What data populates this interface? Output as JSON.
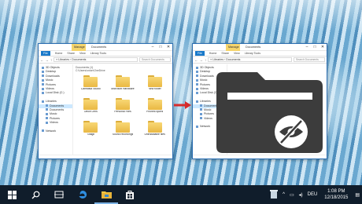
{
  "window_left": {
    "manage_tab": "Manage",
    "title": "Documents",
    "ribbon_tabs": [
      "File",
      "Home",
      "Share",
      "View",
      "Library Tools"
    ],
    "path": "« Libraries › Documents",
    "search_placeholder": "Search Documents",
    "location_line1": "Documents (1)",
    "location_line2": "C:\\Users\\onion\\OneDrive",
    "nav_items": [
      {
        "label": "3D Objects",
        "sel": false,
        "sub": false
      },
      {
        "label": "Desktop",
        "sel": false,
        "sub": false
      },
      {
        "label": "Downloads",
        "sel": false,
        "sub": false
      },
      {
        "label": "Music",
        "sel": false,
        "sub": false
      },
      {
        "label": "Pictures",
        "sel": false,
        "sub": false
      },
      {
        "label": "Videos",
        "sel": false,
        "sub": false
      },
      {
        "label": "Local Disk (C:)",
        "sel": false,
        "sub": false
      },
      {
        "label": "",
        "sel": false,
        "sub": false
      },
      {
        "label": "Libraries",
        "sel": false,
        "sub": false
      },
      {
        "label": "Documents",
        "sel": true,
        "sub": true
      },
      {
        "label": "Documents",
        "sel": false,
        "sub": true
      },
      {
        "label": "Music",
        "sel": false,
        "sub": true
      },
      {
        "label": "Pictures",
        "sel": false,
        "sub": true
      },
      {
        "label": "Videos",
        "sel": false,
        "sub": true
      },
      {
        "label": "",
        "sel": false,
        "sub": false
      },
      {
        "label": "Network",
        "sel": false,
        "sub": false
      }
    ],
    "files": [
      "Camtasia Studio",
      "Microsoft Hardware",
      "New folder",
      "Office Lens",
      "Personal Files",
      "PhoneExports",
      "Snagit",
      "Sound recordings",
      "Uninstallable files"
    ]
  },
  "window_right": {
    "manage_tab": "Manage",
    "title": "Documents",
    "ribbon_tabs": [
      "File",
      "Home",
      "Share",
      "View",
      "Library Tools"
    ],
    "path": "« Libraries › Documents",
    "search_placeholder": "Search Documents",
    "nav_items": [
      {
        "label": "3D Objects",
        "sel": false,
        "sub": false
      },
      {
        "label": "Desktop",
        "sel": false,
        "sub": false
      },
      {
        "label": "Downloads",
        "sel": false,
        "sub": false
      },
      {
        "label": "Music",
        "sel": false,
        "sub": false
      },
      {
        "label": "Pictures",
        "sel": false,
        "sub": false
      },
      {
        "label": "Videos",
        "sel": false,
        "sub": false
      },
      {
        "label": "Local Disk (C:)",
        "sel": false,
        "sub": false
      },
      {
        "label": "",
        "sel": false,
        "sub": false
      },
      {
        "label": "Libraries",
        "sel": false,
        "sub": false
      },
      {
        "label": "Documents",
        "sel": true,
        "sub": true
      },
      {
        "label": "Music",
        "sel": false,
        "sub": true
      },
      {
        "label": "Pictures",
        "sel": false,
        "sub": true
      },
      {
        "label": "Videos",
        "sel": false,
        "sub": true
      },
      {
        "label": "",
        "sel": false,
        "sub": false
      },
      {
        "label": "Network",
        "sel": false,
        "sub": false
      }
    ]
  },
  "overlay": {
    "icon": "hidden-folder-icon",
    "folder_color": "#3c3c3c",
    "eye_bg": "#ffffff"
  },
  "arrow": {
    "icon": "right-arrow-icon",
    "color": "#d62b2b"
  },
  "taskbar": {
    "apps": [
      "start-icon",
      "search-icon",
      "task-view-icon",
      "edge-icon",
      "file-explorer-icon",
      "store-icon"
    ],
    "tray": {
      "language": "DEU",
      "time": "1:08 PM",
      "date": "12/18/2015"
    }
  }
}
